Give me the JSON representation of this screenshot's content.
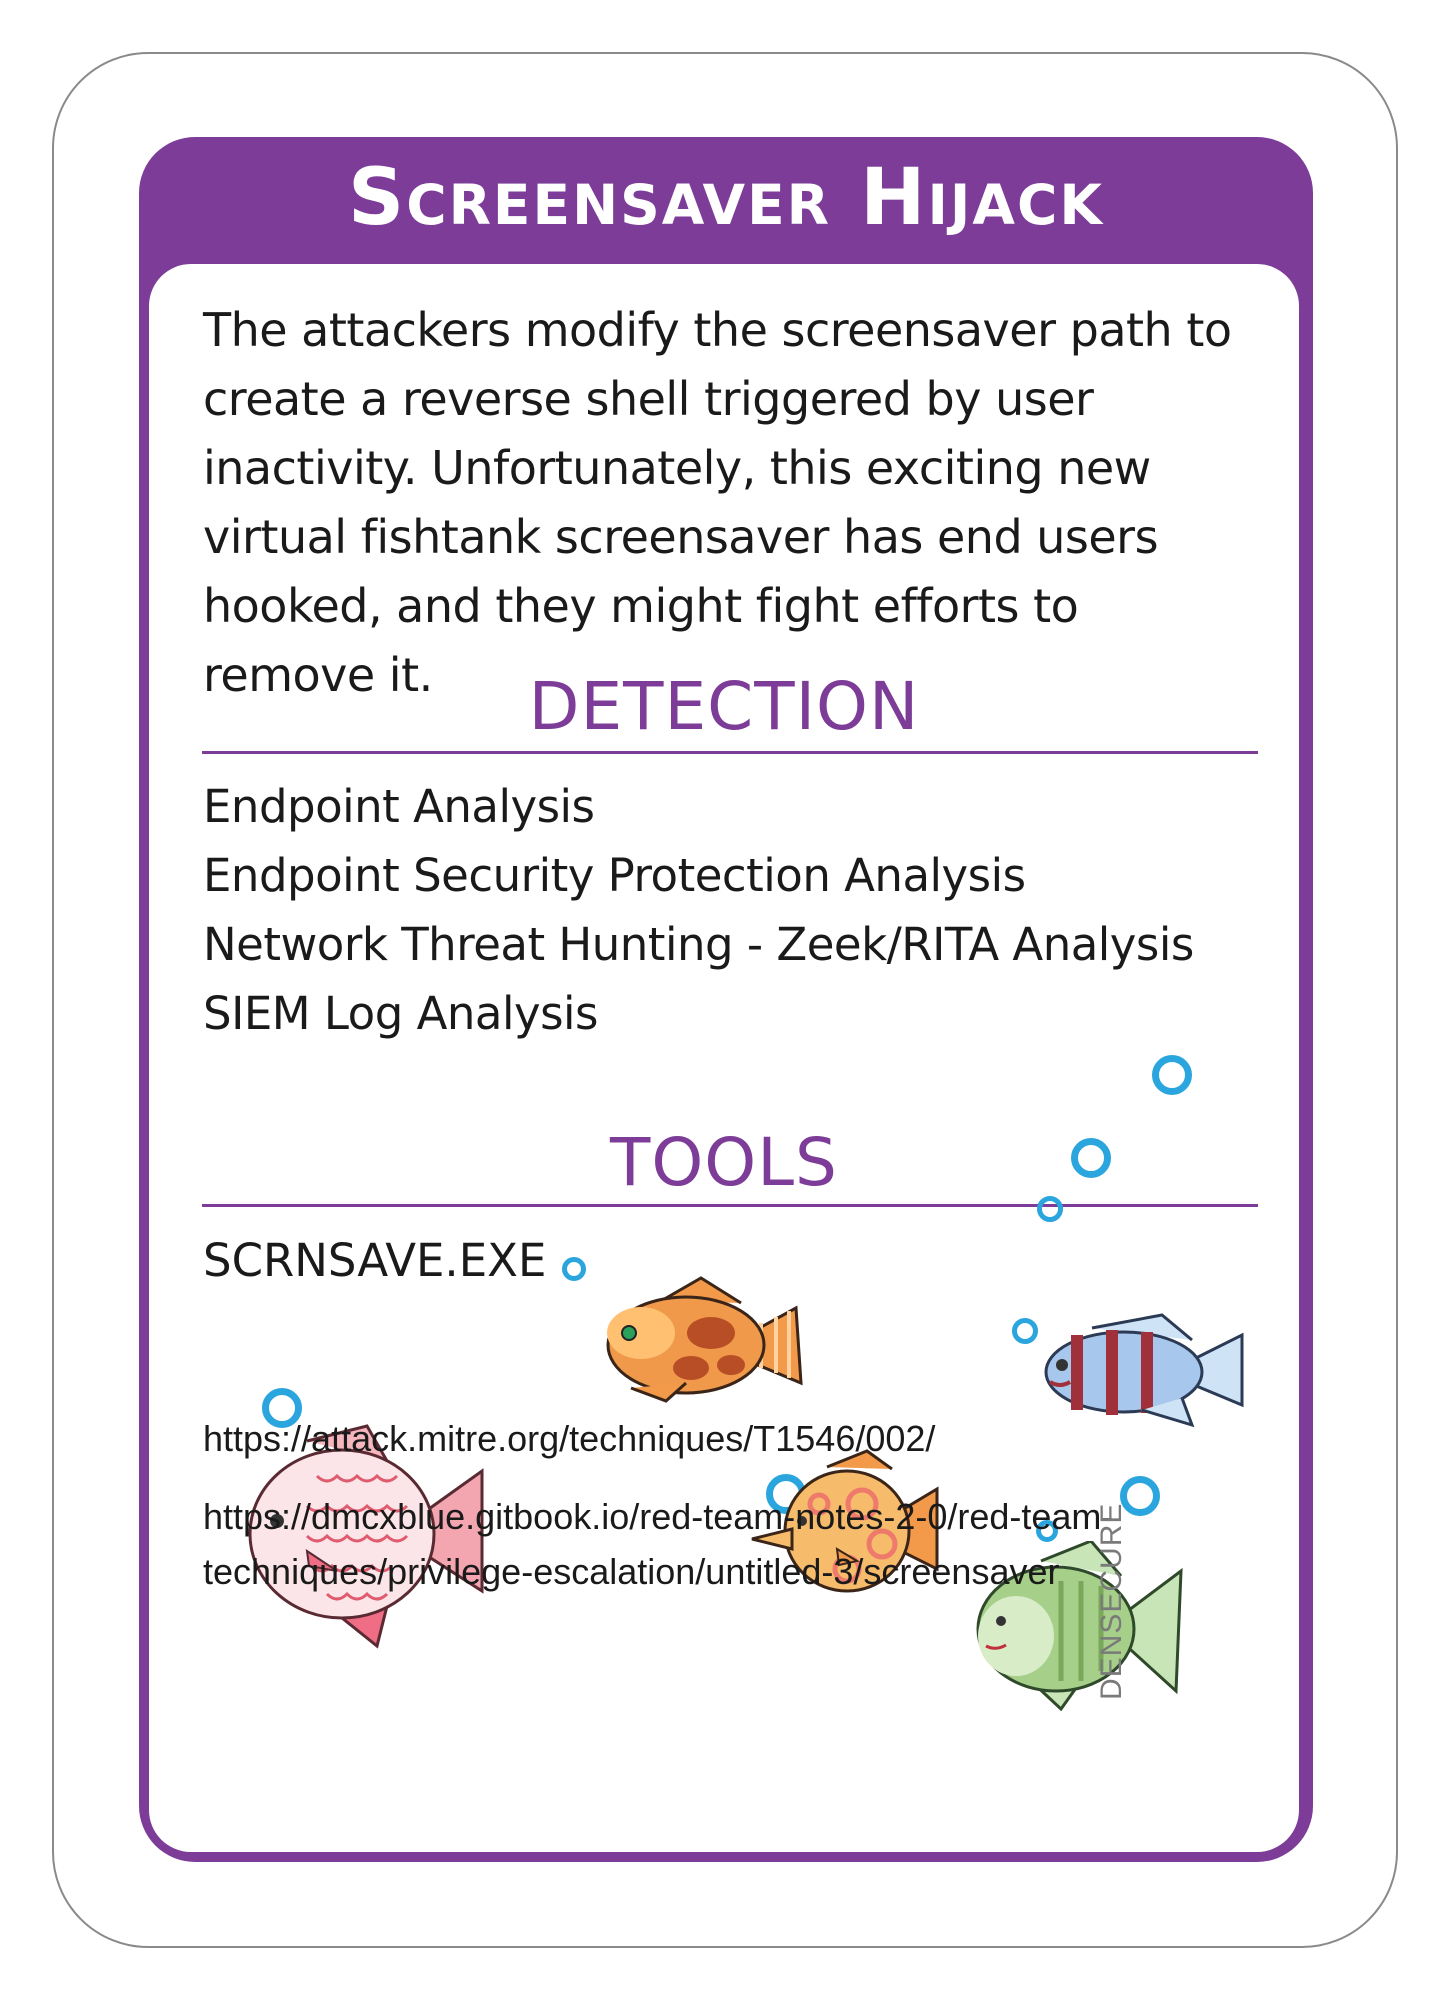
{
  "card": {
    "title": "Screensaver Hijack",
    "description": "The attackers modify the screensaver path to create a reverse shell triggered by user inactivity. Unfortunately, this exciting new virtual fishtank screensaver has end users hooked, and they might fight efforts to remove it.",
    "detection": {
      "heading": "DETECTION",
      "items": [
        "Endpoint Analysis",
        "Endpoint Security Protection Analysis",
        "Network Threat Hunting - Zeek/RITA Analysis",
        "SIEM Log Analysis"
      ]
    },
    "tools": {
      "heading": "TOOLS",
      "items": [
        "SCRNSAVE.EXE"
      ]
    },
    "links": [
      "https://attack.mitre.org/techniques/T1546/002/",
      "https://dmcxblue.gitbook.io/red-team-notes-2-0/red-team-techniques/privilege-escalation/untitled-3/screensaver"
    ],
    "brand": "DENSECURE",
    "colors": {
      "accent": "#7c3c98",
      "bubble": "#2aa5de",
      "text": "#1a1a1a"
    },
    "decorations": [
      "fish-illustration",
      "bubble-icon"
    ]
  }
}
